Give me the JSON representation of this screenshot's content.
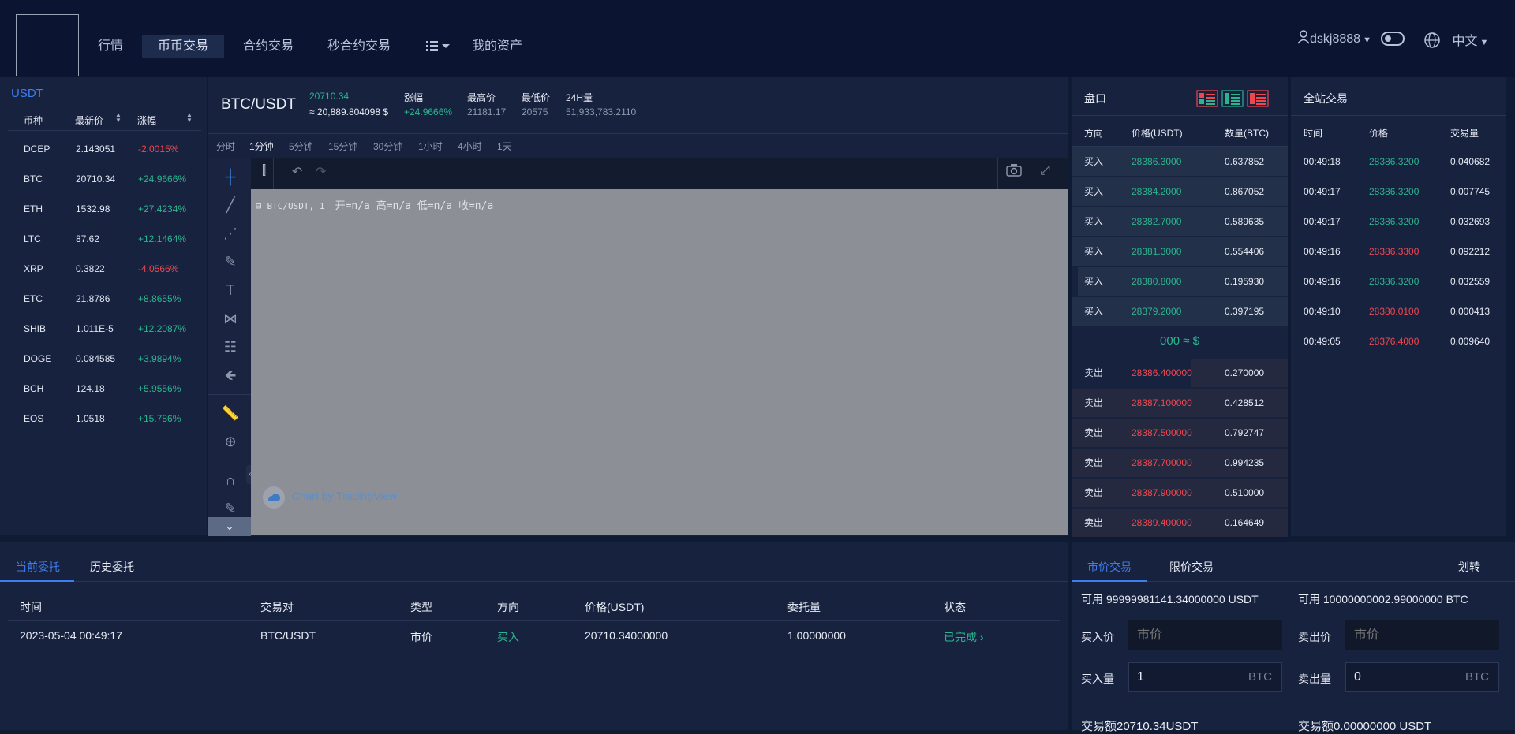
{
  "nav": {
    "items": [
      "行情",
      "币币交易",
      "合约交易",
      "秒合约交易",
      "我的资产"
    ],
    "user": "dskj8888",
    "language": "中文"
  },
  "market": {
    "quote": "USDT",
    "headers": [
      "币种",
      "最新价",
      "涨幅"
    ],
    "rows": [
      {
        "coin": "DCEP",
        "price": "2.143051",
        "change": "-2.0015%",
        "up": false
      },
      {
        "coin": "BTC",
        "price": "20710.34",
        "change": "+24.9666%",
        "up": true
      },
      {
        "coin": "ETH",
        "price": "1532.98",
        "change": "+27.4234%",
        "up": true
      },
      {
        "coin": "LTC",
        "price": "87.62",
        "change": "+12.1464%",
        "up": true
      },
      {
        "coin": "XRP",
        "price": "0.3822",
        "change": "-4.0566%",
        "up": false
      },
      {
        "coin": "ETC",
        "price": "21.8786",
        "change": "+8.8655%",
        "up": true
      },
      {
        "coin": "SHIB",
        "price": "1.011E-5",
        "change": "+12.2087%",
        "up": true
      },
      {
        "coin": "DOGE",
        "price": "0.084585",
        "change": "+3.9894%",
        "up": true
      },
      {
        "coin": "BCH",
        "price": "124.18",
        "change": "+5.9556%",
        "up": true
      },
      {
        "coin": "EOS",
        "price": "1.0518",
        "change": "+15.786%",
        "up": true
      }
    ]
  },
  "ticker": {
    "pair": "BTC/USDT",
    "last": "20710.34",
    "last_usd": "≈ 20,889.804098 $",
    "change_label": "涨幅",
    "change": "+24.9666%",
    "high_label": "最高价",
    "high": "21181.17",
    "low_label": "最低价",
    "low": "20575",
    "vol_label": "24H量",
    "vol": "51,933,783.2110"
  },
  "intervals": [
    "分时",
    "1分钟",
    "5分钟",
    "15分钟",
    "30分钟",
    "1小时",
    "4小时",
    "1天"
  ],
  "chart": {
    "legend": "BTC/USDT, 1",
    "ohlc": "开=n/a  高=n/a  低=n/a  收=n/a",
    "watermark": "Chart by TradingView"
  },
  "orderbook": {
    "title": "盘口",
    "headers": [
      "方向",
      "价格(USDT)",
      "数量(BTC)"
    ],
    "buys": [
      {
        "side": "买入",
        "price": "28386.3000",
        "qty": "0.637852",
        "depth": 1.0
      },
      {
        "side": "买入",
        "price": "28384.2000",
        "qty": "0.867052",
        "depth": 1.0
      },
      {
        "side": "买入",
        "price": "28382.7000",
        "qty": "0.589635",
        "depth": 1.0
      },
      {
        "side": "买入",
        "price": "28381.3000",
        "qty": "0.554406",
        "depth": 1.0
      },
      {
        "side": "买入",
        "price": "28380.8000",
        "qty": "0.195930",
        "depth": 0.97
      },
      {
        "side": "买入",
        "price": "28379.2000",
        "qty": "0.397195",
        "depth": 1.0
      }
    ],
    "mid": "000 ≈ $",
    "sells": [
      {
        "side": "卖出",
        "price": "28386.400000",
        "qty": "0.270000",
        "depth": 0.45
      },
      {
        "side": "卖出",
        "price": "28387.100000",
        "qty": "0.428512",
        "depth": 1.0
      },
      {
        "side": "卖出",
        "price": "28387.500000",
        "qty": "0.792747",
        "depth": 1.0
      },
      {
        "side": "卖出",
        "price": "28387.700000",
        "qty": "0.994235",
        "depth": 1.0
      },
      {
        "side": "卖出",
        "price": "28387.900000",
        "qty": "0.510000",
        "depth": 1.0
      },
      {
        "side": "卖出",
        "price": "28389.400000",
        "qty": "0.164649",
        "depth": 1.0
      }
    ]
  },
  "trades": {
    "title": "全站交易",
    "headers": [
      "时间",
      "价格",
      "交易量"
    ],
    "rows": [
      {
        "time": "00:49:18",
        "price": "28386.3200",
        "qty": "0.040682",
        "up": true
      },
      {
        "time": "00:49:17",
        "price": "28386.3200",
        "qty": "0.007745",
        "up": true
      },
      {
        "time": "00:49:17",
        "price": "28386.3200",
        "qty": "0.032693",
        "up": true
      },
      {
        "time": "00:49:16",
        "price": "28386.3300",
        "qty": "0.092212",
        "up": false
      },
      {
        "time": "00:49:16",
        "price": "28386.3200",
        "qty": "0.032559",
        "up": true
      },
      {
        "time": "00:49:10",
        "price": "28380.0100",
        "qty": "0.000413",
        "up": false
      },
      {
        "time": "00:49:05",
        "price": "28376.4000",
        "qty": "0.009640",
        "up": false
      }
    ]
  },
  "orders": {
    "tabs": [
      "当前委托",
      "历史委托"
    ],
    "headers": [
      "时间",
      "交易对",
      "类型",
      "方向",
      "价格(USDT)",
      "委托量",
      "状态"
    ],
    "rows": [
      {
        "time": "2023-05-04 00:49:17",
        "pair": "BTC/USDT",
        "type": "市价",
        "side": "买入",
        "price": "20710.34000000",
        "qty": "1.00000000",
        "status": "已完成"
      }
    ]
  },
  "form": {
    "tabs": [
      "市价交易",
      "限价交易"
    ],
    "transfer": "划转",
    "buy_avail": "可用 99999981141.34000000 USDT",
    "sell_avail": "可用 10000000002.99000000 BTC",
    "buy_price_label": "买入价",
    "sell_price_label": "卖出价",
    "price_placeholder": "市价",
    "buy_qty_label": "买入量",
    "sell_qty_label": "卖出量",
    "buy_qty": "1",
    "sell_qty": "0",
    "unit": "BTC",
    "buy_total": "交易额20710.34USDT",
    "sell_total": "交易额0.00000000 USDT"
  }
}
